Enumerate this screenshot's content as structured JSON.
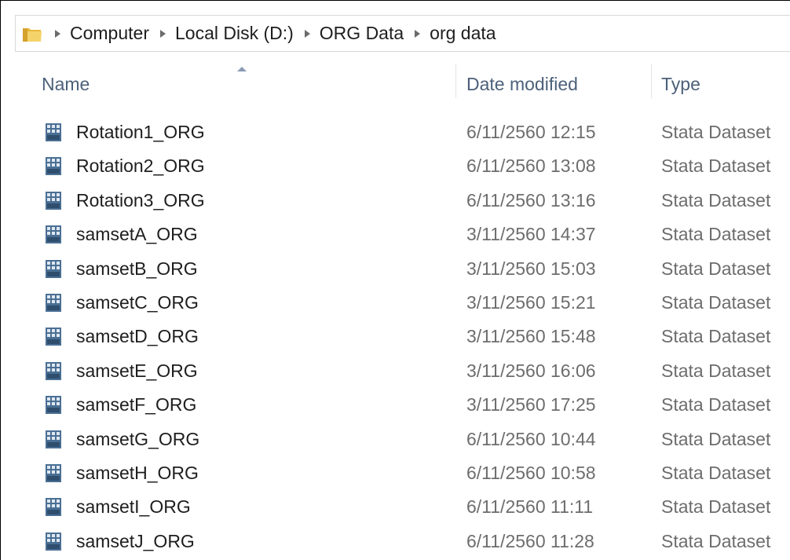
{
  "breadcrumb": [
    "Computer",
    "Local Disk (D:)",
    "ORG Data",
    "org data"
  ],
  "columns": {
    "name": "Name",
    "date": "Date modified",
    "type": "Type"
  },
  "icons": {
    "folder": "folder-icon",
    "file": "stata-dataset-icon",
    "separator": "chevron-right-icon",
    "sort": "sort-ascending-icon"
  },
  "colors": {
    "header_text": "#4c607a",
    "secondary_text": "#6d6d6d",
    "folder_yellow": "#e8b93a",
    "file_blue": "#4a6f94"
  },
  "files": [
    {
      "name": "Rotation1_ORG",
      "date": "6/11/2560 12:15",
      "type": "Stata Dataset"
    },
    {
      "name": "Rotation2_ORG",
      "date": "6/11/2560 13:08",
      "type": "Stata Dataset"
    },
    {
      "name": "Rotation3_ORG",
      "date": "6/11/2560 13:16",
      "type": "Stata Dataset"
    },
    {
      "name": "samsetA_ORG",
      "date": "3/11/2560 14:37",
      "type": "Stata Dataset"
    },
    {
      "name": "samsetB_ORG",
      "date": "3/11/2560 15:03",
      "type": "Stata Dataset"
    },
    {
      "name": "samsetC_ORG",
      "date": "3/11/2560 15:21",
      "type": "Stata Dataset"
    },
    {
      "name": "samsetD_ORG",
      "date": "3/11/2560 15:48",
      "type": "Stata Dataset"
    },
    {
      "name": "samsetE_ORG",
      "date": "3/11/2560 16:06",
      "type": "Stata Dataset"
    },
    {
      "name": "samsetF_ORG",
      "date": "3/11/2560 17:25",
      "type": "Stata Dataset"
    },
    {
      "name": "samsetG_ORG",
      "date": "6/11/2560 10:44",
      "type": "Stata Dataset"
    },
    {
      "name": "samsetH_ORG",
      "date": "6/11/2560 10:58",
      "type": "Stata Dataset"
    },
    {
      "name": "samsetI_ORG",
      "date": "6/11/2560 11:11",
      "type": "Stata Dataset"
    },
    {
      "name": "samsetJ_ORG",
      "date": "6/11/2560 11:28",
      "type": "Stata Dataset"
    }
  ]
}
